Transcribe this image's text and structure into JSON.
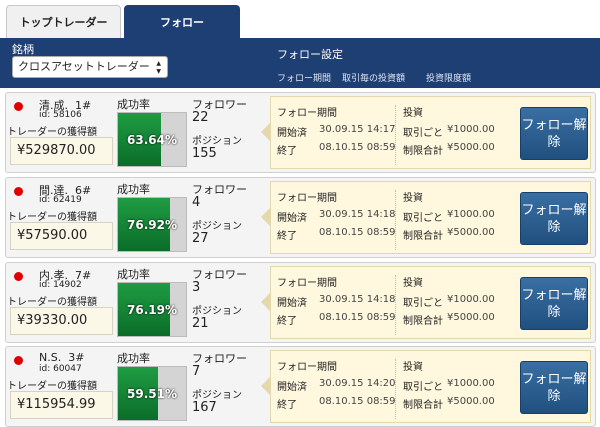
{
  "tabs": [
    {
      "label": "トップトレーダー"
    },
    {
      "label": "フォロー"
    }
  ],
  "header": {
    "filter_label": "銘柄",
    "filter_value": "クロスアセットトレーダー",
    "settings_title": "フォロー設定",
    "col_period": "フォロー期間",
    "col_per_trade": "取引毎の投資額",
    "col_limit": "投資限度額"
  },
  "labels": {
    "gain": "トレーダーの獲得額",
    "success_rate": "成功率",
    "followers": "フォロワー",
    "positions": "ポジション",
    "follow_period": "フォロー期間",
    "started": "開始済",
    "end": "終了",
    "invest": "投資",
    "per_trade": "取引ごと",
    "total_limit": "制限合計",
    "unfollow": "フォロー解除"
  },
  "traders": [
    {
      "name": "清.成.",
      "rank": "1#",
      "id": "id: 58106",
      "gain": "¥529870.00",
      "success_rate": "63.64%",
      "success_pct": 63.64,
      "followers": "22",
      "positions": "155",
      "start": "30.09.15 14:17",
      "end": "08.10.15 08:59",
      "per_trade": "¥1000.00",
      "total_limit": "¥5000.00"
    },
    {
      "name": "間.達.",
      "rank": "6#",
      "id": "id: 62419",
      "gain": "¥57590.00",
      "success_rate": "76.92%",
      "success_pct": 76.92,
      "followers": "4",
      "positions": "27",
      "start": "30.09.15 14:18",
      "end": "08.10.15 08:59",
      "per_trade": "¥1000.00",
      "total_limit": "¥5000.00"
    },
    {
      "name": "内.孝.",
      "rank": "7#",
      "id": "id: 14902",
      "gain": "¥39330.00",
      "success_rate": "76.19%",
      "success_pct": 76.19,
      "followers": "3",
      "positions": "21",
      "start": "30.09.15 14:18",
      "end": "08.10.15 08:59",
      "per_trade": "¥1000.00",
      "total_limit": "¥5000.00"
    },
    {
      "name": "N.S.",
      "rank": "3#",
      "id": "id: 60047",
      "gain": "¥115954.99",
      "success_rate": "59.51%",
      "success_pct": 59.51,
      "followers": "7",
      "positions": "167",
      "start": "30.09.15 14:20",
      "end": "08.10.15 08:59",
      "per_trade": "¥1000.00",
      "total_limit": "¥5000.00"
    }
  ]
}
